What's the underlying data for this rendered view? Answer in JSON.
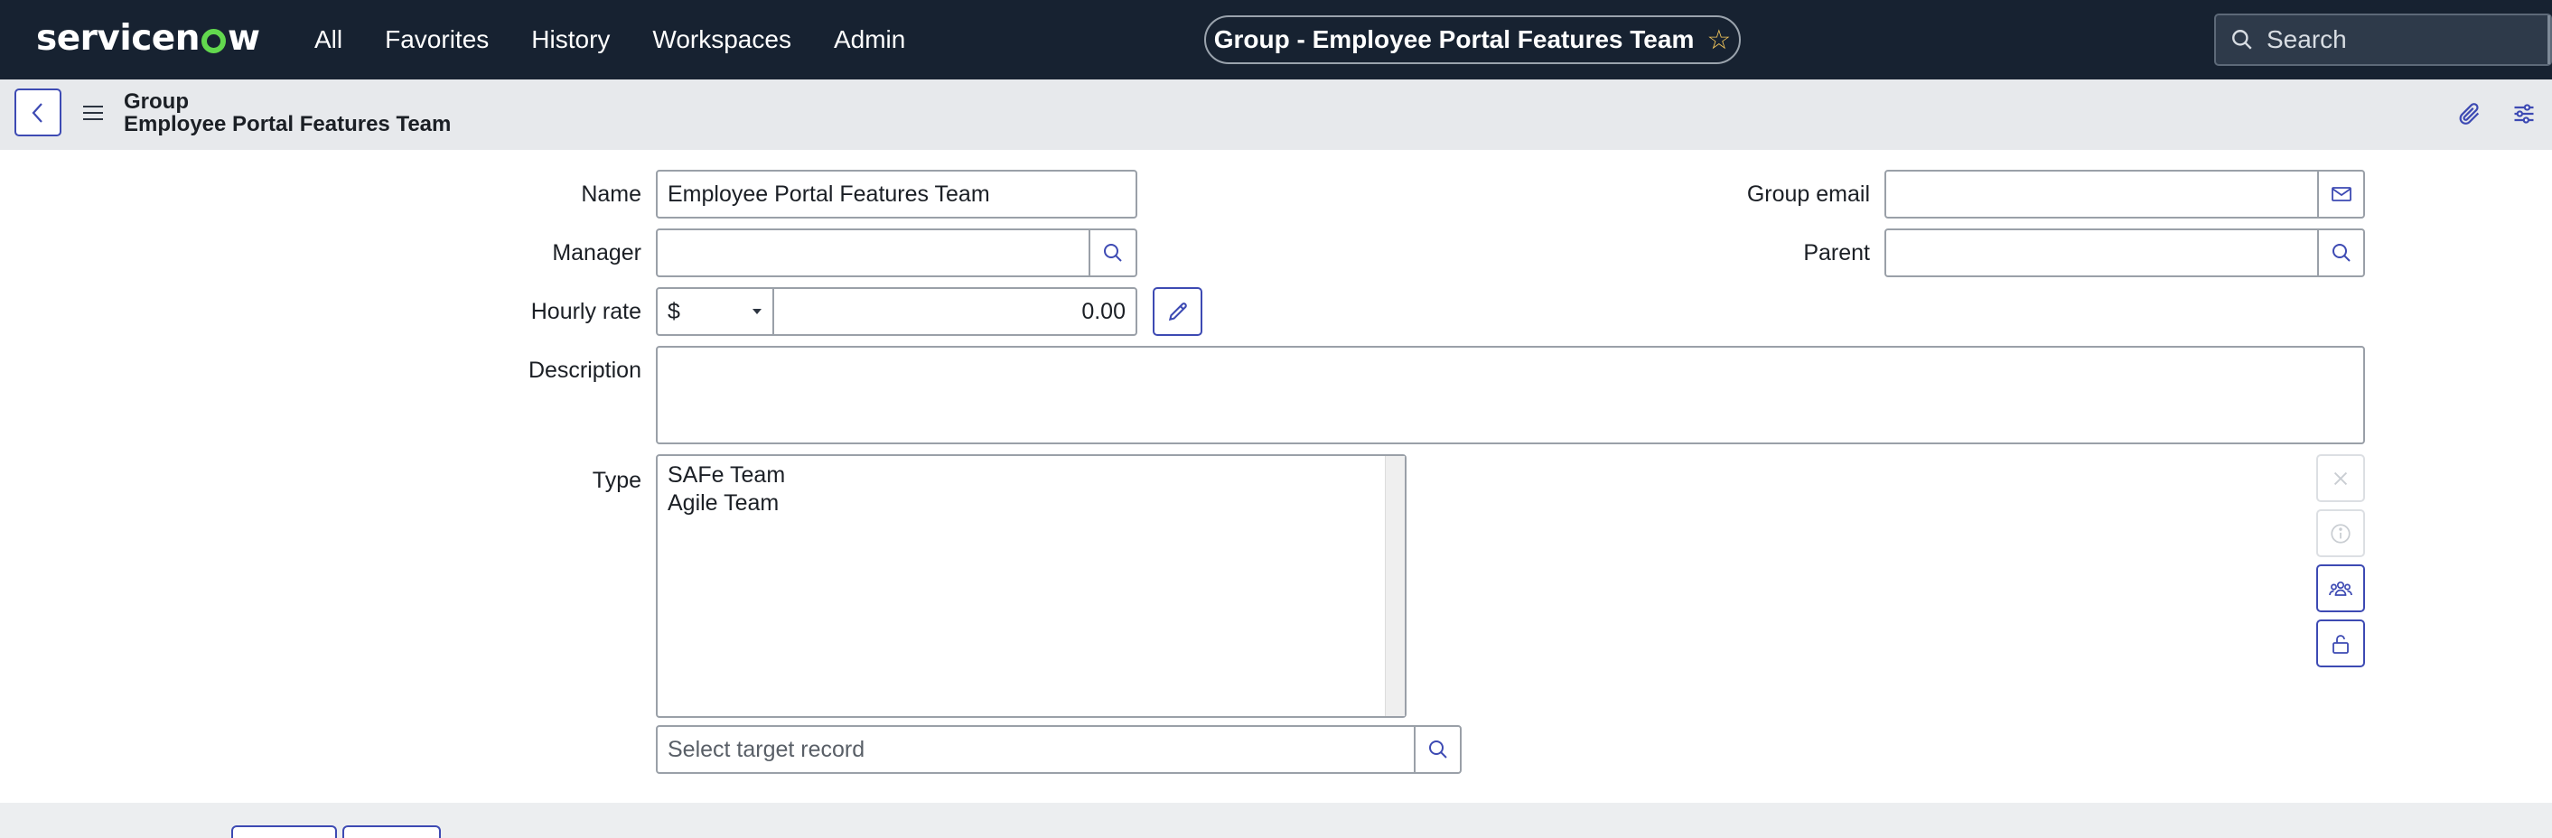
{
  "app": {
    "logo_text_before": "servicen",
    "logo_text_after": "w"
  },
  "nav": {
    "items": [
      "All",
      "Favorites",
      "History",
      "Workspaces",
      "Admin"
    ]
  },
  "context": {
    "title": "Group - Employee Portal Features Team",
    "star_icon": "star-outline-icon"
  },
  "search": {
    "placeholder": "Search"
  },
  "record": {
    "table_label": "Group",
    "display_value": "Employee Portal Features Team"
  },
  "form": {
    "name": {
      "label": "Name",
      "value": "Employee Portal Features Team"
    },
    "manager": {
      "label": "Manager",
      "value": ""
    },
    "hourly_rate": {
      "label": "Hourly rate",
      "currency": "$",
      "amount": "0.00"
    },
    "description": {
      "label": "Description",
      "value": ""
    },
    "type": {
      "label": "Type",
      "items": [
        "SAFe Team",
        "Agile Team"
      ],
      "target_placeholder": "Select target record"
    },
    "group_email": {
      "label": "Group email",
      "value": ""
    },
    "parent": {
      "label": "Parent",
      "value": ""
    }
  },
  "colors": {
    "topbar": "#172231",
    "accent": "#3d4ab3",
    "logo_o": "#62d84e",
    "star": "#f3c65b"
  }
}
